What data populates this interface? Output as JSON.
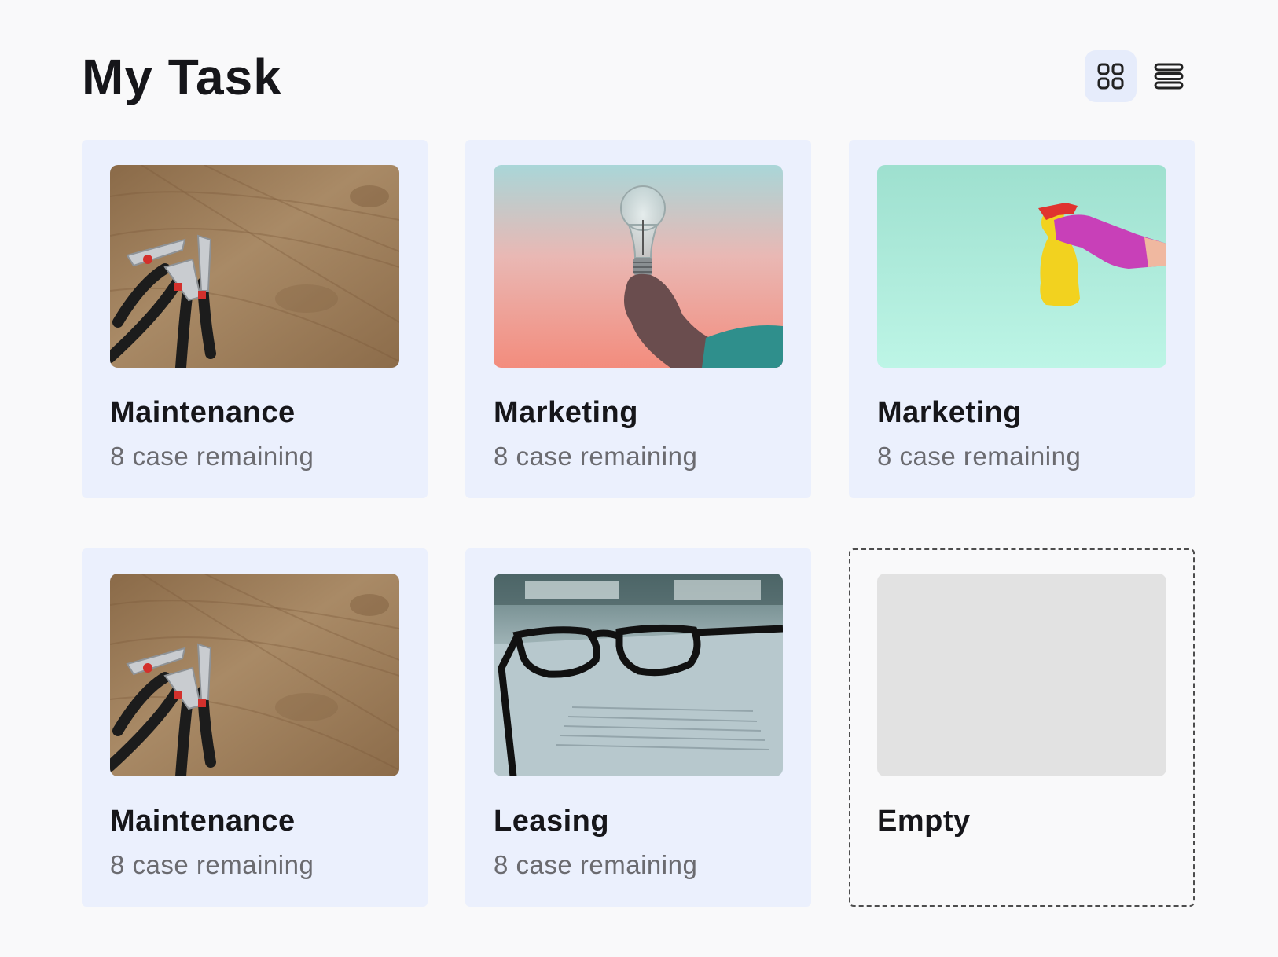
{
  "page": {
    "title": "My Task"
  },
  "view_toggle": {
    "grid_icon": "grid-icon",
    "list_icon": "list-icon",
    "active": "grid"
  },
  "cards": [
    {
      "title": "Maintenance",
      "subtitle": "8 case remaining",
      "image": "tools-pliers-on-wood"
    },
    {
      "title": "Marketing",
      "subtitle": "8 case remaining",
      "image": "hand-holding-lightbulb"
    },
    {
      "title": "Marketing",
      "subtitle": "8 case remaining",
      "image": "hand-spray-bottle"
    },
    {
      "title": "Maintenance",
      "subtitle": "8 case remaining",
      "image": "tools-pliers-on-wood"
    },
    {
      "title": "Leasing",
      "subtitle": "8 case remaining",
      "image": "glasses-on-document"
    },
    {
      "title": "Empty",
      "image": "placeholder"
    }
  ],
  "colors": {
    "card_bg": "#ebf0fd",
    "toggle_active_bg": "#e6ecfb",
    "title": "#16161a",
    "subtitle": "#6b6b70",
    "placeholder": "#e2e2e2"
  }
}
